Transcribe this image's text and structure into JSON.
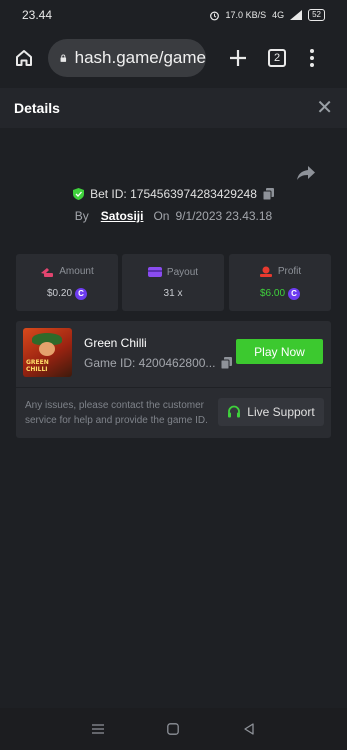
{
  "status_bar": {
    "time": "23.44",
    "network_speed": "17.0 KB/S",
    "signal": "4G",
    "battery": "52"
  },
  "browser": {
    "url": "hash.game/game",
    "tab_count": "2"
  },
  "details": {
    "title": "Details"
  },
  "bet": {
    "id_label": "Bet ID: 1754563974283429248",
    "by_label": "By",
    "username": "Satosiji",
    "on_label": "On",
    "date": "9/1/2023 23.43.18"
  },
  "stats": {
    "amount_label": "Amount",
    "amount_value": "$0.20",
    "payout_label": "Payout",
    "payout_value": "31 x",
    "profit_label": "Profit",
    "profit_value": "$6.00"
  },
  "game": {
    "title": "Green Chilli",
    "game_id": "Game ID: 4200462800...",
    "play_label": "Play Now",
    "thumb_text": "GREEN CHILLI",
    "issue_text": "Any issues, please contact the customer service for help and provide the game ID.",
    "support_label": "Live Support"
  },
  "colors": {
    "background": "#1e2024",
    "panel": "#2a2c31",
    "accent_green": "#3cc92f",
    "coin_purple": "#6d3cf0",
    "amount_icon": "#e2456f",
    "payout_icon": "#8a4cf0",
    "profit_icon": "#e83a2f"
  },
  "icons": {
    "home": "home-icon",
    "lock": "lock-icon",
    "plus": "plus-icon",
    "tabs": "tabs-icon",
    "menu": "more-vertical-icon",
    "close": "close-icon",
    "share": "share-icon",
    "verified": "shield-check-icon",
    "copy": "copy-icon",
    "amount": "amount-icon",
    "payout": "wallet-icon",
    "profit": "profit-icon",
    "coin": "coin-icon",
    "headset": "headset-icon",
    "nav_recent": "recent-apps-icon",
    "nav_home": "nav-home-icon",
    "nav_back": "back-icon"
  }
}
